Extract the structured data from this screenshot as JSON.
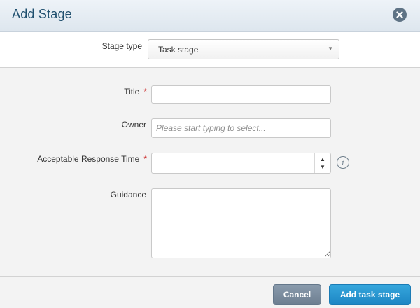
{
  "dialog": {
    "title": "Add Stage",
    "close_icon": "close-circle-icon"
  },
  "stage_type": {
    "label": "Stage type",
    "selected": "Task stage"
  },
  "form": {
    "title": {
      "label": "Title",
      "required_mark": "*",
      "value": ""
    },
    "owner": {
      "label": "Owner",
      "placeholder": "Please start typing to select...",
      "value": ""
    },
    "response_time": {
      "label": "Acceptable Response Time",
      "required_mark": "*",
      "value": "",
      "info_icon": "info-icon"
    },
    "guidance": {
      "label": "Guidance",
      "value": ""
    }
  },
  "footer": {
    "cancel_label": "Cancel",
    "submit_label": "Add task stage"
  },
  "colors": {
    "header_title": "#1f4f6e",
    "required": "#cc2a2a",
    "primary_button": "#1d86c4",
    "secondary_button": "#6d7f91"
  }
}
